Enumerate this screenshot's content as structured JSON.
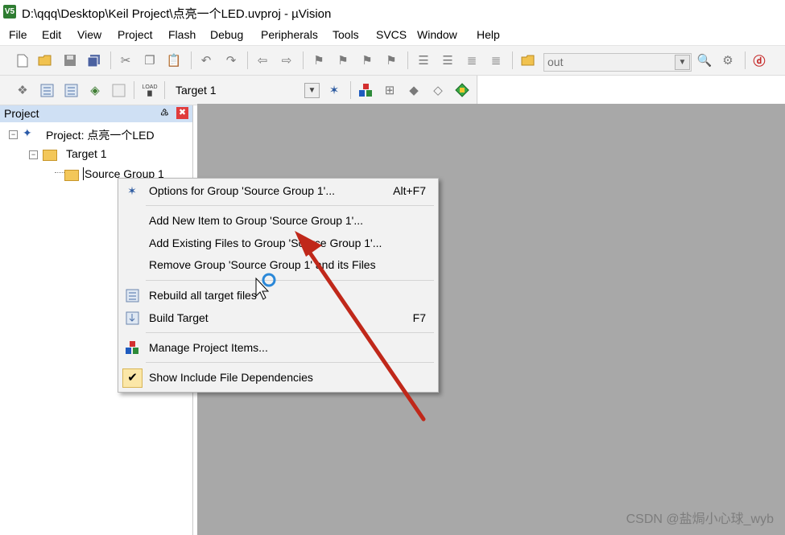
{
  "window": {
    "title": "D:\\qqq\\Desktop\\Keil Project\\点亮一个LED.uvproj - µVision",
    "app_icon_text": "V5"
  },
  "menubar": [
    "File",
    "Edit",
    "View",
    "Project",
    "Flash",
    "Debug",
    "Peripherals",
    "Tools",
    "SVCS",
    "Window",
    "Help"
  ],
  "toolbar1": {
    "find_value": "out"
  },
  "toolbar2": {
    "target_value": "Target 1",
    "load_label": "LOAD"
  },
  "project_panel": {
    "title": "Project",
    "pin_glyph": "♵",
    "close_glyph": "✖",
    "tree": {
      "project_label": "Project: 点亮一个LED",
      "target_label": "Target 1",
      "group_label": "Source Group 1",
      "expander_glyph": "−"
    }
  },
  "context_menu": {
    "items": [
      {
        "label": "Options for Group 'Source Group 1'...",
        "shortcut": "Alt+F7",
        "icon": "magic-wand-icon"
      },
      {
        "label": "Add New  Item to Group 'Source Group 1'..."
      },
      {
        "label": "Add Existing Files to Group 'Source Group 1'..."
      },
      {
        "label": "Remove Group 'Source Group 1' and its Files"
      },
      {
        "label": "Rebuild all target files",
        "icon": "rebuild-icon"
      },
      {
        "label": "Build Target",
        "shortcut": "F7",
        "icon": "build-icon"
      },
      {
        "label": "Manage Project Items...",
        "icon": "manage-items-icon"
      },
      {
        "label": "Show Include File Dependencies",
        "checked": true,
        "check_glyph": "✔"
      }
    ]
  },
  "watermark": "CSDN @盐焗小心球_wyb",
  "colors": {
    "workspace": "#a8a8a8",
    "panel_header": "#cfe0f4",
    "arrow": "#c0281a",
    "check_bg": "#fbe7a8"
  }
}
